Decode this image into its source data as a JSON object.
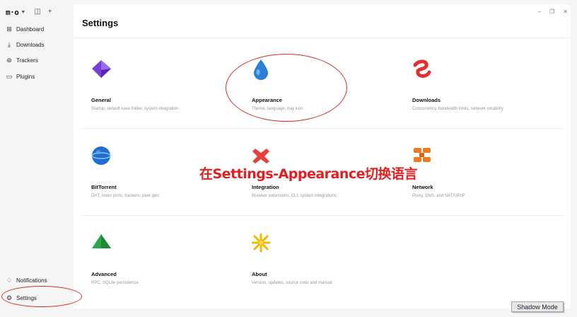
{
  "app": {
    "logo": "m·o",
    "nav": [
      {
        "label": "Dashboard",
        "icon": "grid-icon"
      },
      {
        "label": "Downloads",
        "icon": "download-icon"
      },
      {
        "label": "Trackers",
        "icon": "signal-icon"
      },
      {
        "label": "Plugins",
        "icon": "folder-icon"
      }
    ],
    "bottom_nav": [
      {
        "label": "Notifications",
        "icon": "bell-icon"
      },
      {
        "label": "Settings",
        "icon": "gear-icon"
      }
    ]
  },
  "settings": {
    "title": "Settings",
    "tiles": [
      {
        "name": "General",
        "desc": "Startup, default save folder, system integration",
        "icon": "purple-octahedron-icon"
      },
      {
        "name": "Appearance",
        "desc": "Theme, language, tray icon",
        "icon": "blue-drop-icon"
      },
      {
        "name": "Downloads",
        "desc": "Concurrency, bandwidth limits, network reliability",
        "icon": "red-knot-icon"
      },
      {
        "name": "BitTorrent",
        "desc": "DHT, listen ports, trackers, peer geo",
        "icon": "blue-sphere-icon"
      },
      {
        "name": "Integration",
        "desc": "Browser extensions, CLI, system integrations",
        "icon": "red-cross-icon"
      },
      {
        "name": "Network",
        "desc": "Proxy, DNS, and NAT/UPnP",
        "icon": "orange-links-icon"
      },
      {
        "name": "Advanced",
        "desc": "RPC, SQLite persistence",
        "icon": "green-pyramid-icon"
      },
      {
        "name": "About",
        "desc": "Version, updates, source code and manual",
        "icon": "yellow-star-icon"
      }
    ]
  },
  "annotation": {
    "text": "在Settings-Appearance切换语言",
    "color": "#e02020"
  },
  "overlay": {
    "shadow_mode": "Shadow Mode"
  }
}
